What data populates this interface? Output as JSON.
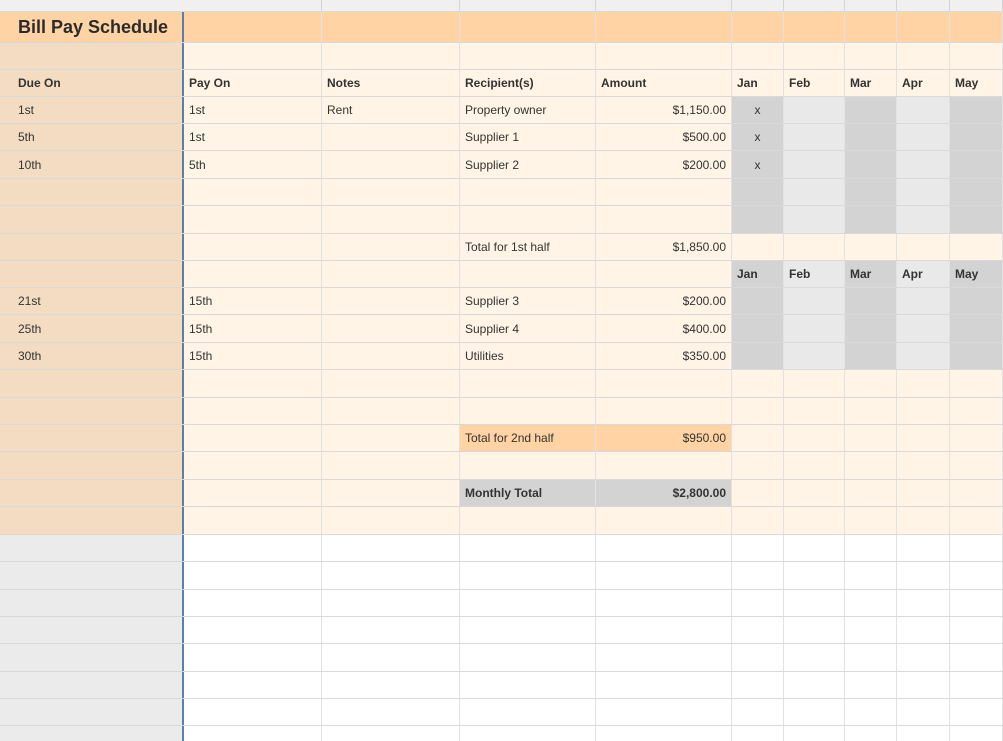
{
  "sheet": {
    "title": "Bill Pay Schedule",
    "headers": {
      "due_on": "Due On",
      "pay_on": "Pay On",
      "notes": "Notes",
      "recipient": "Recipient(s)",
      "amount": "Amount",
      "months": [
        "Jan",
        "Feb",
        "Mar",
        "Apr",
        "May"
      ]
    },
    "first_half": [
      {
        "due": "1st",
        "pay": "1st",
        "notes": "Rent",
        "recipient": "Property owner",
        "amount": "$1,150.00",
        "jan": "x"
      },
      {
        "due": "5th",
        "pay": "1st",
        "notes": "",
        "recipient": "Supplier 1",
        "amount": "$500.00",
        "jan": "x"
      },
      {
        "due": "10th",
        "pay": "5th",
        "notes": "",
        "recipient": "Supplier 2",
        "amount": "$200.00",
        "jan": "x"
      }
    ],
    "total_1st_half": {
      "label": "Total for 1st half",
      "amount": "$1,850.00"
    },
    "second_half": [
      {
        "due": "21st",
        "pay": "15th",
        "notes": "",
        "recipient": "Supplier 3",
        "amount": "$200.00"
      },
      {
        "due": "25th",
        "pay": "15th",
        "notes": "",
        "recipient": "Supplier 4",
        "amount": "$400.00"
      },
      {
        "due": "30th",
        "pay": "15th",
        "notes": "",
        "recipient": "Utilities",
        "amount": "$350.00"
      }
    ],
    "total_2nd_half": {
      "label": "Total for 2nd half",
      "amount": "$950.00"
    },
    "monthly_total": {
      "label": "Monthly Total",
      "amount": "$2,800.00"
    }
  }
}
